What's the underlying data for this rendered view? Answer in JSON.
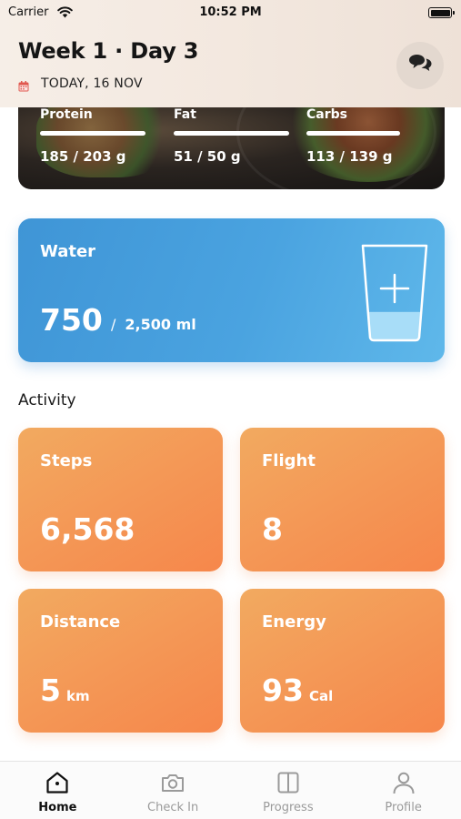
{
  "status_bar": {
    "carrier": "Carrier",
    "time": "10:52 PM"
  },
  "header": {
    "title": "Week 1 · Day 3",
    "date": "TODAY, 16 NOV",
    "chat_icon": "chat-bubbles-icon"
  },
  "macros": [
    {
      "label": "Protein",
      "value": "185 / 203 g"
    },
    {
      "label": "Fat",
      "value": "51 / 50 g"
    },
    {
      "label": "Carbs",
      "value": "113 / 139 g"
    }
  ],
  "water": {
    "label": "Water",
    "amount": "750",
    "goal": "2,500 ml",
    "separator": "/",
    "fill_fraction": 0.3,
    "add_icon": "glass-plus-icon"
  },
  "activity": {
    "title": "Activity",
    "tiles": [
      {
        "label": "Steps",
        "value": "6,568",
        "unit": ""
      },
      {
        "label": "Flight",
        "value": "8",
        "unit": ""
      },
      {
        "label": "Distance",
        "value": "5",
        "unit": "km"
      },
      {
        "label": "Energy",
        "value": "93",
        "unit": "Cal"
      }
    ]
  },
  "tabs": [
    {
      "label": "Home",
      "icon": "home-icon",
      "active": true
    },
    {
      "label": "Check In",
      "icon": "camera-icon",
      "active": false
    },
    {
      "label": "Progress",
      "icon": "columns-icon",
      "active": false
    },
    {
      "label": "Profile",
      "icon": "person-icon",
      "active": false
    }
  ],
  "colors": {
    "water_blue": "#4aa3e0",
    "activity_orange": "#f49655",
    "calendar_red": "#e0584f"
  }
}
